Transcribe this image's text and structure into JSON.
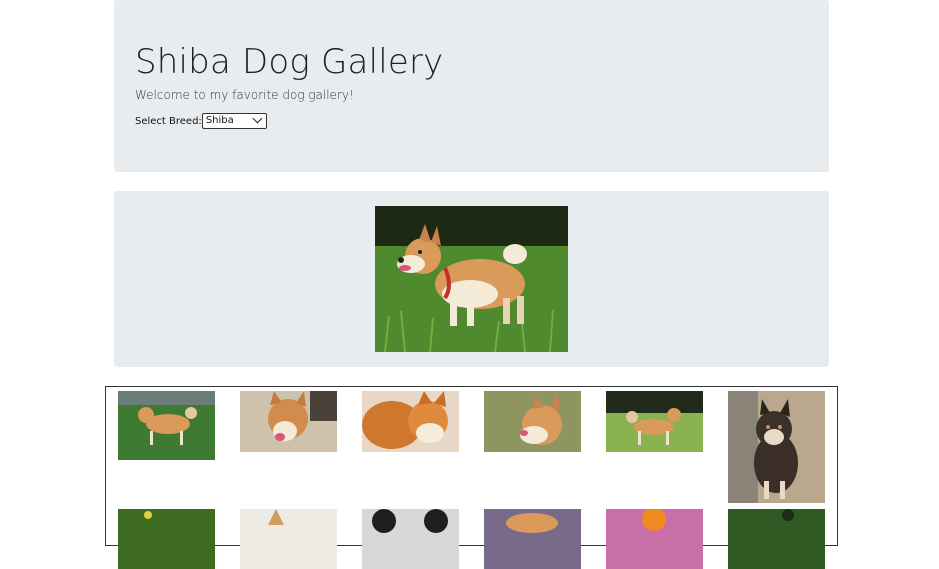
{
  "header": {
    "title": "Shiba Dog Gallery",
    "subtitle": "Welcome to my favorite dog gallery!",
    "select_label": "Select Breed:",
    "select_value": "Shiba"
  },
  "feature": {
    "alt": "shiba dog with red harness standing in grass"
  },
  "gallery": {
    "thumbs": [
      "shiba standing on turf",
      "shiba sitting with tongue out",
      "close-up shiba curled",
      "shiba licking nose",
      "shiba walking on grass",
      "black and tan shiba portrait",
      "shiba in garden",
      "cream shiba",
      "black shiba",
      "shiba puppy face",
      "shiba with toy",
      "dark shiba outdoors"
    ]
  },
  "colors": {
    "panel_bg": "#e9ecef",
    "shiba_coat": "#d99a5a",
    "grass": "#4f8a2e"
  }
}
